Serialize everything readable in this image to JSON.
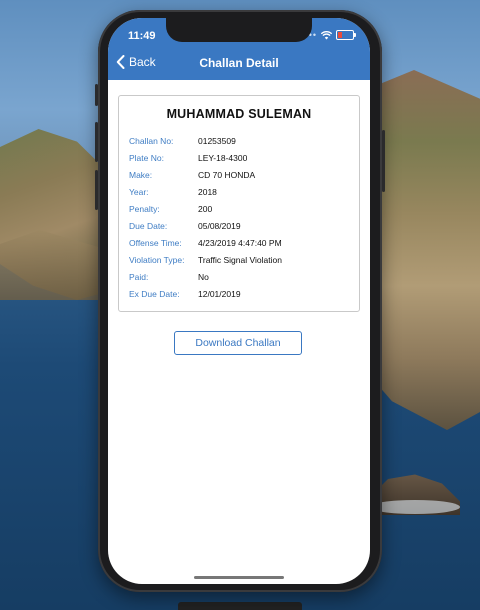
{
  "status": {
    "time": "11:49"
  },
  "nav": {
    "back_label": "Back",
    "title": "Challan Detail"
  },
  "card": {
    "name": "MUHAMMAD SULEMAN",
    "rows": [
      {
        "label": "Challan No:",
        "value": "01253509"
      },
      {
        "label": "Plate No:",
        "value": "LEY-18-4300"
      },
      {
        "label": "Make:",
        "value": "CD 70 HONDA"
      },
      {
        "label": "Year:",
        "value": "2018"
      },
      {
        "label": "Penalty:",
        "value": "200"
      },
      {
        "label": "Due Date:",
        "value": "05/08/2019"
      },
      {
        "label": "Offense Time:",
        "value": "4/23/2019 4:47:40 PM"
      },
      {
        "label": "Violation Type:",
        "value": "Traffic Signal Violation"
      },
      {
        "label": "Paid:",
        "value": "No"
      },
      {
        "label": "Ex Due Date:",
        "value": "12/01/2019"
      }
    ]
  },
  "actions": {
    "download_label": "Download Challan"
  },
  "icons": {
    "back": "chevron-left-icon",
    "wifi": "wifi-icon",
    "battery": "battery-icon"
  },
  "colors": {
    "accent": "#3a78c2",
    "label": "#3f7dc4"
  }
}
